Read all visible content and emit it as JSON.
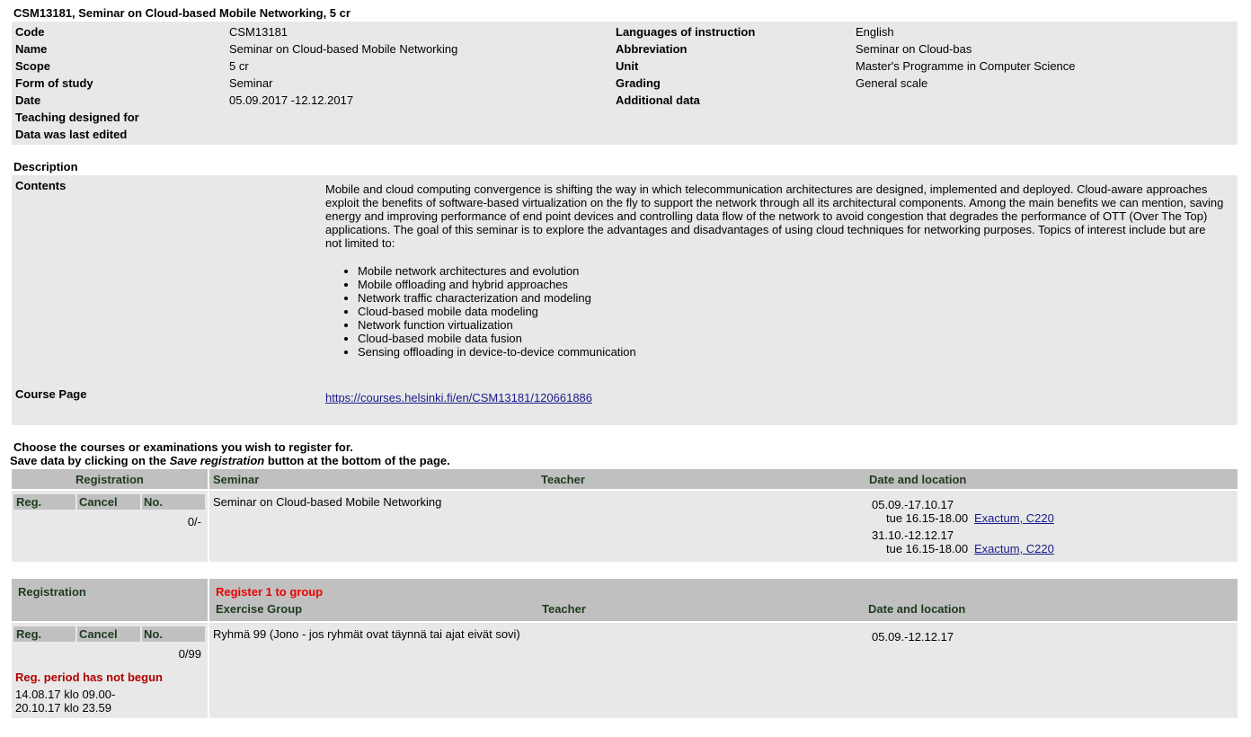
{
  "page_title": "CSM13181, Seminar on Cloud-based Mobile Networking, 5 cr",
  "info_left": [
    {
      "label": "Code",
      "value": "CSM13181"
    },
    {
      "label": "Name",
      "value": "Seminar on Cloud-based Mobile Networking"
    },
    {
      "label": "Scope",
      "value": "5 cr"
    },
    {
      "label": "Form of study",
      "value": "Seminar"
    },
    {
      "label": "Date",
      "value": "05.09.2017 -12.12.2017"
    },
    {
      "label": "Teaching designed for",
      "value": ""
    },
    {
      "label": "Data was last edited",
      "value": ""
    }
  ],
  "info_right": [
    {
      "label": "Languages of instruction",
      "value": "English"
    },
    {
      "label": "Abbreviation",
      "value": "Seminar on Cloud-bas"
    },
    {
      "label": "Unit",
      "value": "Master's Programme in Computer Science"
    },
    {
      "label": "Grading",
      "value": "General scale"
    },
    {
      "label": "Additional data",
      "value": ""
    }
  ],
  "description": {
    "heading": "Description",
    "contents_label": "Contents",
    "contents_text": "Mobile and cloud computing convergence is shifting the way in which telecommunication architectures are designed, implemented and deployed. Cloud-aware approaches exploit the benefits of software-based virtualization on the fly to support the network through all its architectural components. Among the main benefits we can mention, saving energy and improving performance of end point devices and controlling data flow of the network to avoid congestion that degrades the performance of OTT (Over The Top) applications. The goal of this seminar is to explore the advantages and disadvantages of using cloud techniques for networking purposes. Topics of interest include but are not limited to:",
    "topics": [
      "Mobile network architectures and evolution",
      "Mobile offloading and hybrid approaches",
      "Network traffic characterization and modeling",
      "Cloud-based mobile data modeling",
      "Network function virtualization",
      "Cloud-based mobile data fusion",
      "Sensing offloading in device-to-device communication"
    ],
    "course_page_label": "Course Page",
    "course_page_url": "https://courses.helsinki.fi/en/CSM13181/120661886"
  },
  "instructions": {
    "line1": "Choose the courses or examinations you wish to register for.",
    "line2_pre": "Save data by clicking on the ",
    "line2_em": "Save registration",
    "line2_post": " button at the bottom of the page."
  },
  "seminar": {
    "registration_header": "Registration",
    "col_seminar": "Seminar",
    "col_teacher": "Teacher",
    "col_date_location": "Date and location",
    "sub_reg": "Reg.",
    "sub_cancel": "Cancel",
    "sub_no": "No.",
    "count": "0/-",
    "name": "Seminar on Cloud-based Mobile Networking",
    "sessions": [
      {
        "dates": "05.09.-17.10.17",
        "time": "tue 16.15-18.00",
        "location": "Exactum, C220"
      },
      {
        "dates": "31.10.-12.12.17",
        "time": "tue 16.15-18.00",
        "location": "Exactum, C220"
      }
    ]
  },
  "exercise": {
    "registration_header": "Registration",
    "register_note": "Register 1 to group",
    "col_group": "Exercise Group",
    "col_teacher": "Teacher",
    "col_date_location": "Date and location",
    "sub_reg": "Reg.",
    "sub_cancel": "Cancel",
    "sub_no": "No.",
    "count": "0/99",
    "status": "Reg. period has not begun",
    "period_start": "14.08.17 klo 09.00-",
    "period_end": "20.10.17 klo 23.59",
    "group_name": "Ryhmä 99 (Jono - jos ryhmät ovat täynnä tai ajat eivät sovi)",
    "group_dates": "05.09.-12.12.17"
  },
  "colors": {
    "panel_bg": "#e8e8e8",
    "header_bg": "#c0c0c0",
    "link": "#1a1a8c",
    "red_note": "#ee0000",
    "status_red": "#b00000"
  }
}
